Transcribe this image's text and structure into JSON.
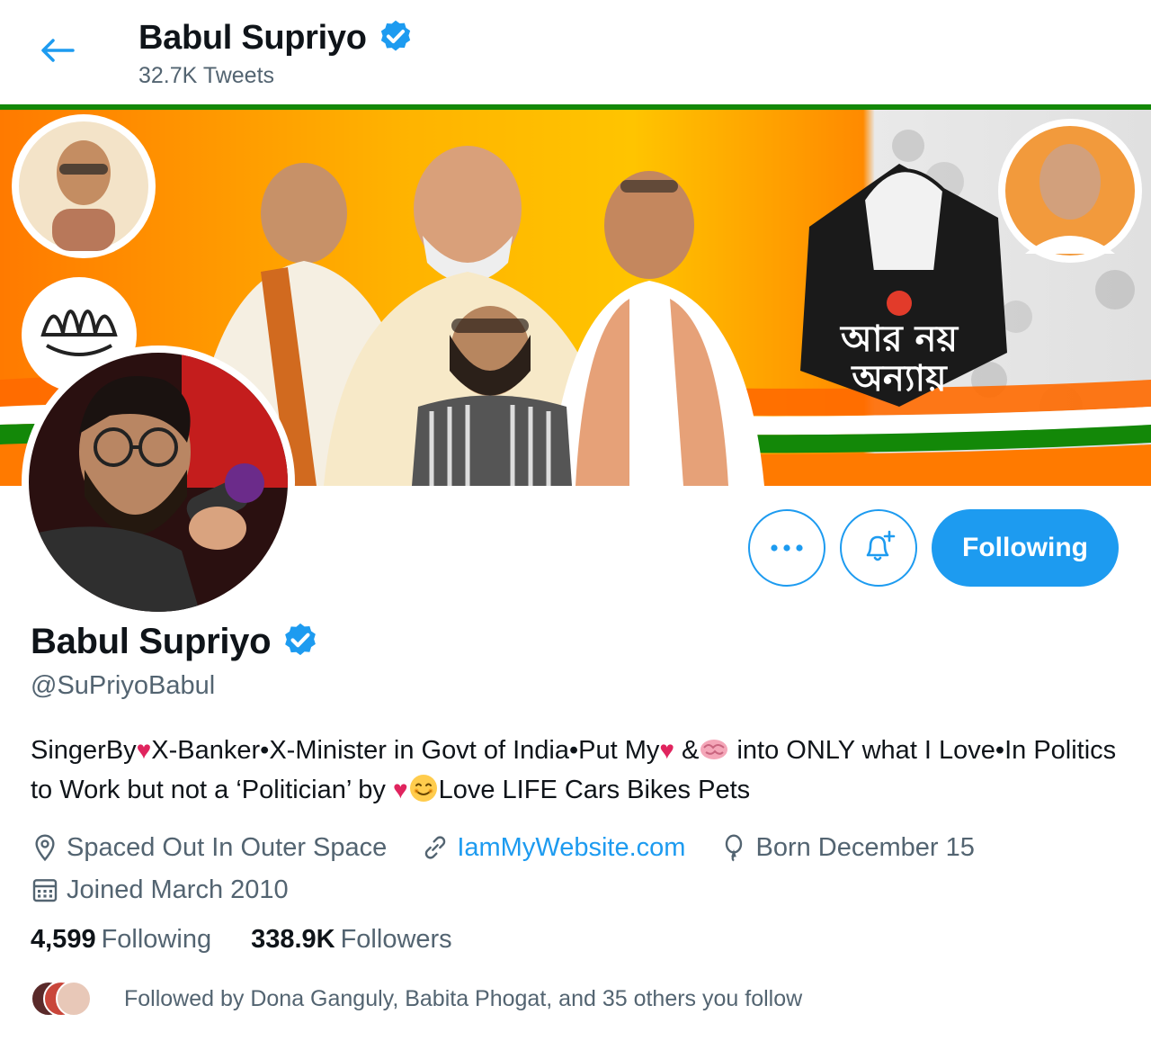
{
  "header": {
    "name": "Babul Supriyo",
    "tweet_count": "32.7K Tweets"
  },
  "profile": {
    "name": "Babul Supriyo",
    "handle": "@SuPriyoBabul",
    "bio": {
      "segment1": "SingerBy",
      "segment2": "X-Banker•X-Minister in Govt of India•Put My",
      "segment3": " &",
      "segment4": " into ONLY what I Love•In Politics to Work but not a ‘Politician’ by ",
      "segment5": "Love LIFE Cars Bikes Pets"
    },
    "location": "Spaced Out In Outer Space",
    "website": "IamMyWebsite.com",
    "birthday": "Born December 15",
    "joined": "Joined March 2010",
    "following_count": "4,599",
    "following_label": "Following",
    "followers_count": "338.9K",
    "followers_label": "Followers",
    "followed_by": "Followed by Dona Ganguly, Babita Phogat, and 35 others you follow"
  },
  "actions": {
    "following_button": "Following"
  },
  "banner": {
    "slogan_line1": "আর নয়",
    "slogan_line2": "অন্যায়"
  },
  "icons": {
    "back": "back-arrow-icon",
    "verified": "verified-badge-icon",
    "more": "more-icon",
    "notify": "bell-plus-icon",
    "location": "location-pin-icon",
    "link": "link-icon",
    "birthday": "balloon-icon",
    "calendar": "calendar-icon"
  },
  "colors": {
    "accent": "#1d9bf0",
    "text_primary": "#0f1419",
    "text_secondary": "#536471"
  }
}
